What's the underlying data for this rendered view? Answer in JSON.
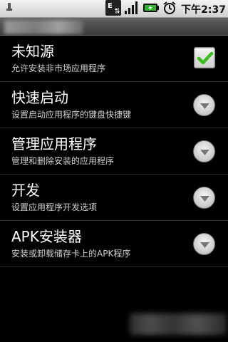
{
  "status_bar": {
    "time": "下午2:37",
    "network_type": "E",
    "icons": [
      "usb-icon",
      "data-transfer-icon",
      "signal-icon",
      "battery-charging-icon",
      "alarm-icon"
    ]
  },
  "settings": {
    "items": [
      {
        "title": "未知源",
        "subtitle": "允许安装非市场应用程序",
        "control": "checkbox",
        "checked": true
      },
      {
        "title": "快速启动",
        "subtitle": "设置启动应用程序的键盘快捷键",
        "control": "chevron"
      },
      {
        "title": "管理应用程序",
        "subtitle": "管理和删除安装的应用程序",
        "control": "chevron"
      },
      {
        "title": "开发",
        "subtitle": "设置应用程序开发选项",
        "control": "chevron"
      },
      {
        "title": "APK安装器",
        "subtitle": "安装或卸载储存卡上的APK程序",
        "control": "chevron"
      }
    ]
  },
  "colors": {
    "background": "#000000",
    "check_green": "#3bbd1c"
  }
}
